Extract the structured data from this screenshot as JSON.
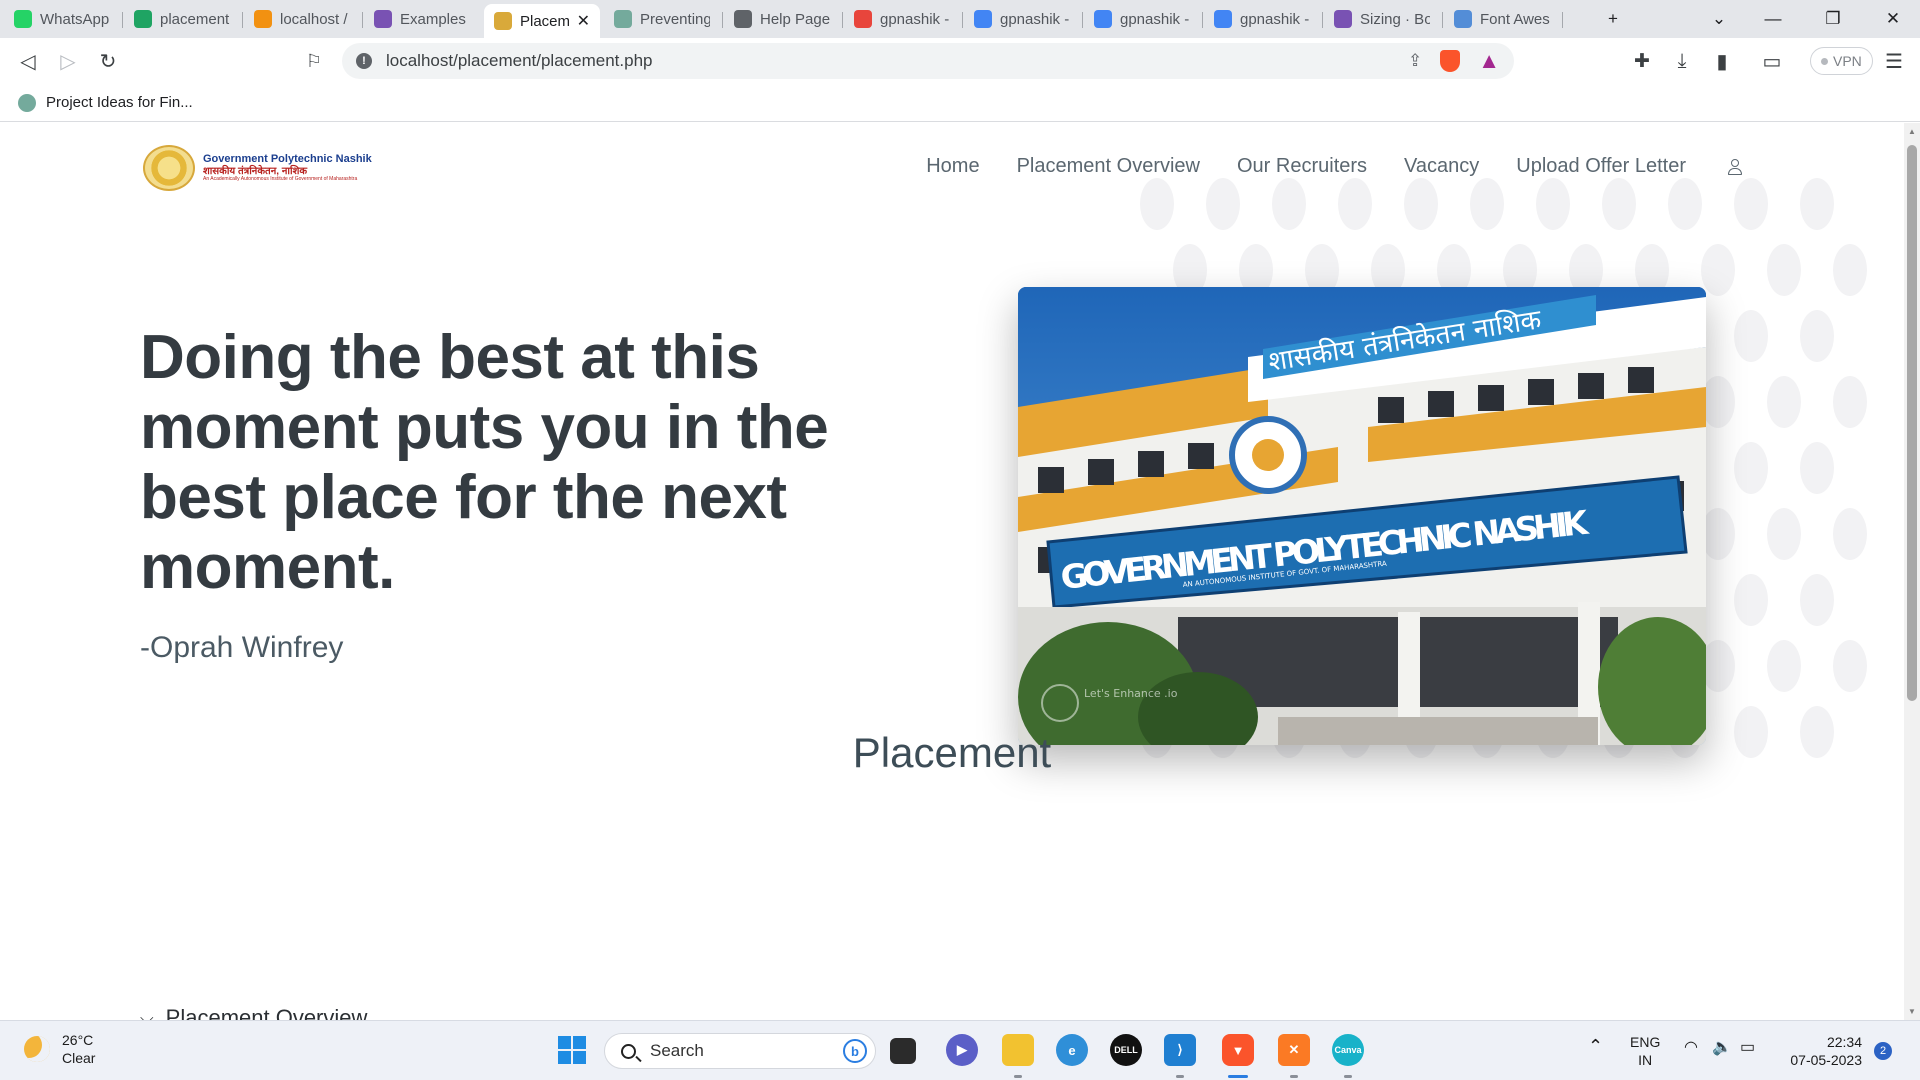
{
  "browser": {
    "tabs": [
      {
        "title": "WhatsApp",
        "icon": "whatsapp-icon",
        "color": "#25d366"
      },
      {
        "title": "placement",
        "icon": "google-drive-icon",
        "color": "#1fa463"
      },
      {
        "title": "localhost /",
        "icon": "phpmyadmin-icon",
        "color": "#f29111"
      },
      {
        "title": "Examples ·",
        "icon": "bootstrap-icon",
        "color": "#7952b3"
      },
      {
        "title": "Placem",
        "icon": "college-seal-icon",
        "color": "#d9a93a",
        "active": true
      },
      {
        "title": "Preventing",
        "icon": "chatgpt-icon",
        "color": "#74aa9c"
      },
      {
        "title": "Help Page",
        "icon": "globe-icon",
        "color": "#5f6368"
      },
      {
        "title": "gpnashik -",
        "icon": "brave-shield-icon",
        "color": "#e8453c"
      },
      {
        "title": "gpnashik -",
        "icon": "google-icon",
        "color": "#4285f4"
      },
      {
        "title": "gpnashik -",
        "icon": "google-icon",
        "color": "#4285f4"
      },
      {
        "title": "gpnashik -",
        "icon": "google-icon",
        "color": "#4285f4"
      },
      {
        "title": "Sizing · Boo",
        "icon": "bootstrap-icon",
        "color": "#7952b3"
      },
      {
        "title": "Font Aweso",
        "icon": "font-awesome-flag-icon",
        "color": "#538dd7"
      }
    ],
    "url": "localhost/placement/placement.php",
    "bookmark": "Project Ideas for Fin...",
    "vpn_label": "VPN"
  },
  "site": {
    "logo": {
      "name_en": "Government Polytechnic Nashik",
      "name_mr": "शासकीय तंत्रनिकेतन, नाशिक",
      "tagline": "An Academically Autonomous Institute of Government of Maharashtra"
    },
    "nav": [
      "Home",
      "Placement Overview",
      "Our Recruiters",
      "Vacancy",
      "Upload Offer Letter"
    ],
    "hero": {
      "quote": "Doing the best at this moment puts you in the best place for the next moment.",
      "author": "-Oprah Winfrey"
    },
    "photo": {
      "sign_mr": "शासकीय तंत्रनिकेतन नाशिक",
      "sign_en": "GOVERNMENT POLYTECHNIC NASHIK",
      "sign_sub": "AN AUTONOMOUS INSTITUTE OF GOVT. OF MAHARASHTRA",
      "watermark": "Let's Enhance .io"
    },
    "section_title": "Placement",
    "accordion_label": "Placement Overview"
  },
  "taskbar": {
    "temperature": "26°C",
    "condition": "Clear",
    "search_label": "Search",
    "lang": "ENG",
    "region": "IN",
    "time": "22:34",
    "date": "07-05-2023",
    "notifications": "2"
  }
}
